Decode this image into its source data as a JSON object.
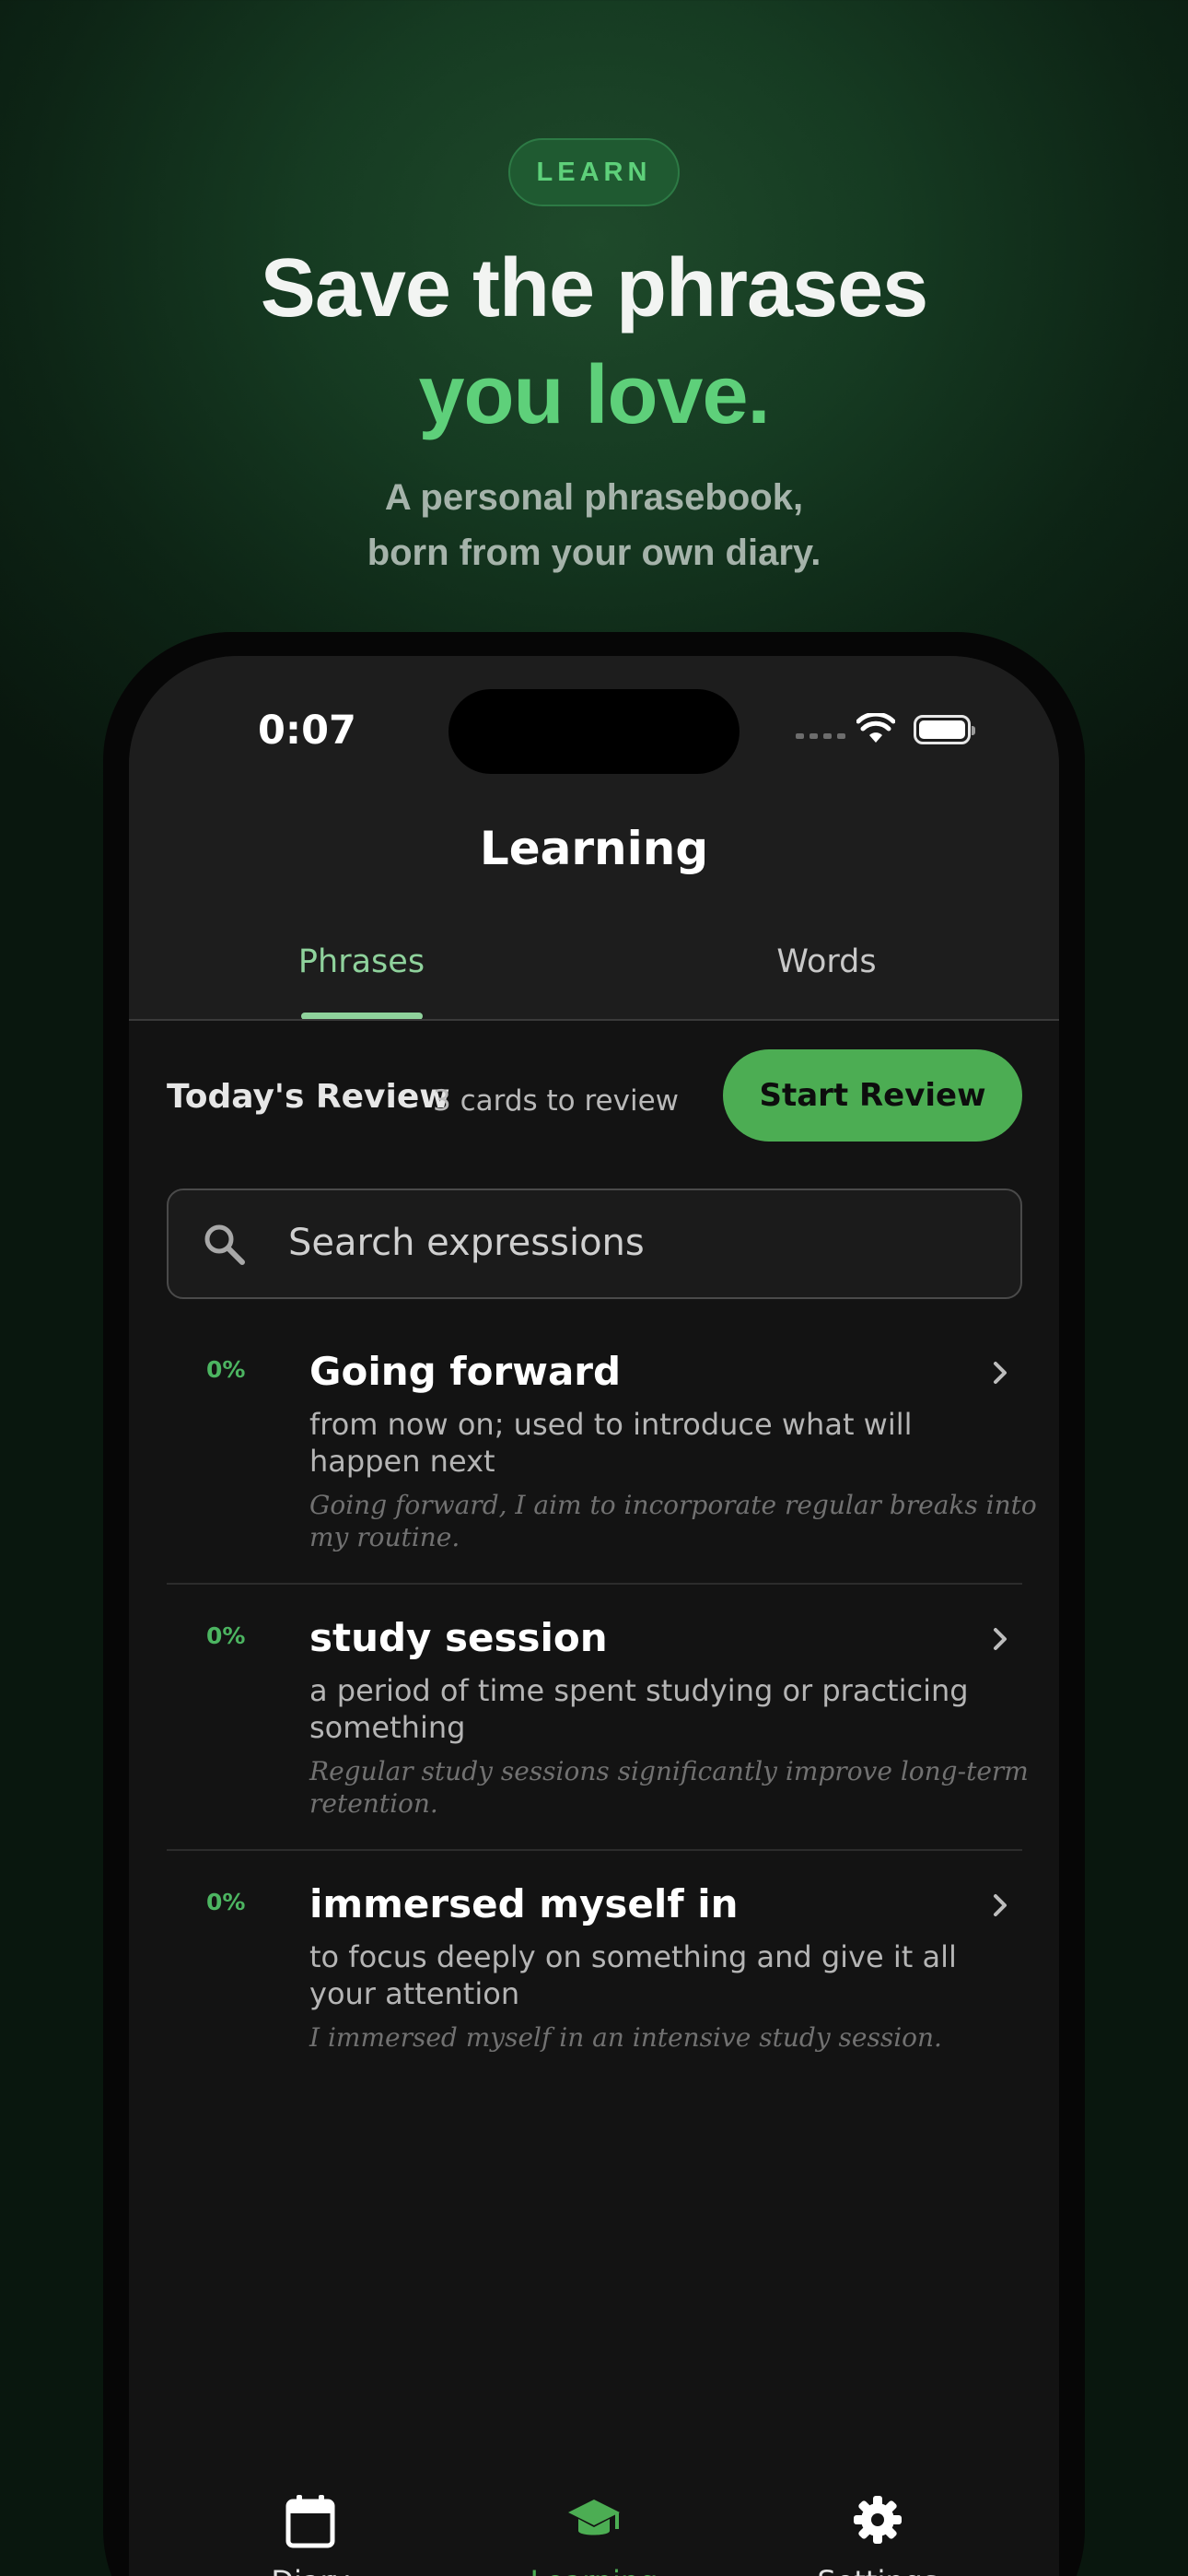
{
  "hero": {
    "pill": "LEARN",
    "headline_line1": "Save the phrases",
    "headline_line2": "you love.",
    "sub_line1": "A personal phrasebook,",
    "sub_line2": "born from your own diary."
  },
  "status_bar": {
    "time": "0:07"
  },
  "screen": {
    "title": "Learning",
    "tabs": [
      {
        "label": "Phrases",
        "selected": true
      },
      {
        "label": "Words",
        "selected": false
      }
    ],
    "review": {
      "label": "Today's Review",
      "count_text": "3 cards to review",
      "button_label": "Start Review"
    },
    "search": {
      "placeholder": "Search expressions"
    },
    "items": [
      {
        "progress": "0%",
        "phrase": "Going forward",
        "meaning": "from now on; used to introduce what will happen next",
        "example": "Going forward, I aim to incorporate regular breaks into my routine."
      },
      {
        "progress": "0%",
        "phrase": "study session",
        "meaning": "a period of time spent studying or practicing something",
        "example": "Regular study sessions significantly improve long-term retention."
      },
      {
        "progress": "0%",
        "phrase": "immersed myself in",
        "meaning": "to focus deeply on something and give it all your attention",
        "example": "I immersed myself in an intensive study session."
      }
    ],
    "tabbar": [
      {
        "label": "Diary",
        "icon": "calendar-icon",
        "active": false
      },
      {
        "label": "Learning",
        "icon": "graduation-cap-icon",
        "active": true
      },
      {
        "label": "Settings",
        "icon": "gear-icon",
        "active": false
      }
    ]
  },
  "colors": {
    "accent": "#4cad53",
    "accent_light": "#5ed07a",
    "tab_active": "#8fd29c",
    "screen_bg": "#131313"
  }
}
